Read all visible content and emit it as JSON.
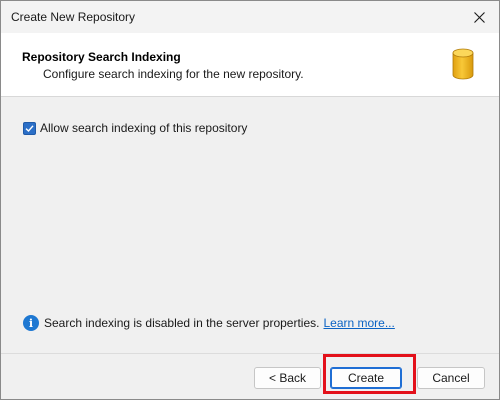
{
  "window": {
    "title": "Create New Repository"
  },
  "header": {
    "title": "Repository Search Indexing",
    "subtitle": "Configure search indexing for the new repository.",
    "icon": "database-icon"
  },
  "options": {
    "search_indexing": {
      "label": "Allow search indexing of this repository",
      "checked": true
    }
  },
  "info": {
    "icon": "info-icon",
    "message": "Search indexing is disabled in the server properties.",
    "link_text": "Learn more..."
  },
  "buttons": {
    "back": "< Back",
    "create": "Create",
    "cancel": "Cancel"
  },
  "colors": {
    "accent": "#1f6ed4",
    "checkbox": "#2b6fc7",
    "link": "#0b63c4",
    "highlight": "#e3101a",
    "db_icon": "#f2b51e"
  }
}
